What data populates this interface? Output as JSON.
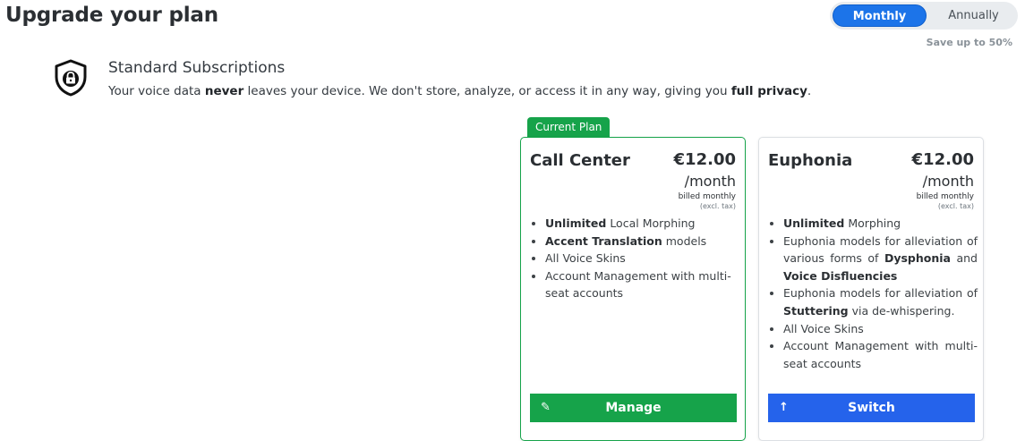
{
  "header": {
    "title": "Upgrade your plan"
  },
  "billing": {
    "monthly_label": "Monthly",
    "annually_label": "Annually",
    "selected": "Monthly",
    "save_note": "Save up to 50%"
  },
  "subscriptions": {
    "icon": "shield-lock-icon",
    "title": "Standard Subscriptions",
    "privacy": {
      "part1": "Your voice data ",
      "bold1": "never",
      "part2": " leaves your device. We don't store, analyze, or access it in any way, giving you ",
      "bold2": "full privacy",
      "part3": "."
    }
  },
  "plans": [
    {
      "badge": "Current Plan",
      "name": "Call Center",
      "price": "€12.00",
      "period": "/month",
      "billed": "billed monthly",
      "tax": "(excl. tax)",
      "features": {
        "f1_bold": "Unlimited",
        "f1_text": " Local Morphing",
        "f2_bold": "Accent Translation",
        "f2_text": " models",
        "f3_text": "All Voice Skins",
        "f4_text": "Account Management with multi-seat accounts"
      },
      "button_label": "Manage",
      "button_icon": "pencil-icon",
      "accent": "#16a34a"
    },
    {
      "name": "Euphonia",
      "price": "€12.00",
      "period": "/month",
      "billed": "billed monthly",
      "tax": "(excl. tax)",
      "features": {
        "f1_bold": "Unlimited",
        "f1_text": " Morphing",
        "f2_text_a": "Euphonia models for alleviation of various forms of ",
        "f2_bold_a": "Dysphonia",
        "f2_text_b": " and ",
        "f2_bold_b": "Voice Disfluencies",
        "f3_text": "Euphonia models for alleviation of ",
        "f3_bold": "Stuttering",
        "f3_text_b": " via de-whispering.",
        "f4_text": "All Voice Skins",
        "f5_text": "Account Management with multi-seat accounts"
      },
      "button_label": "Switch",
      "button_icon": "arrow-up-icon",
      "accent": "#2563eb"
    }
  ]
}
